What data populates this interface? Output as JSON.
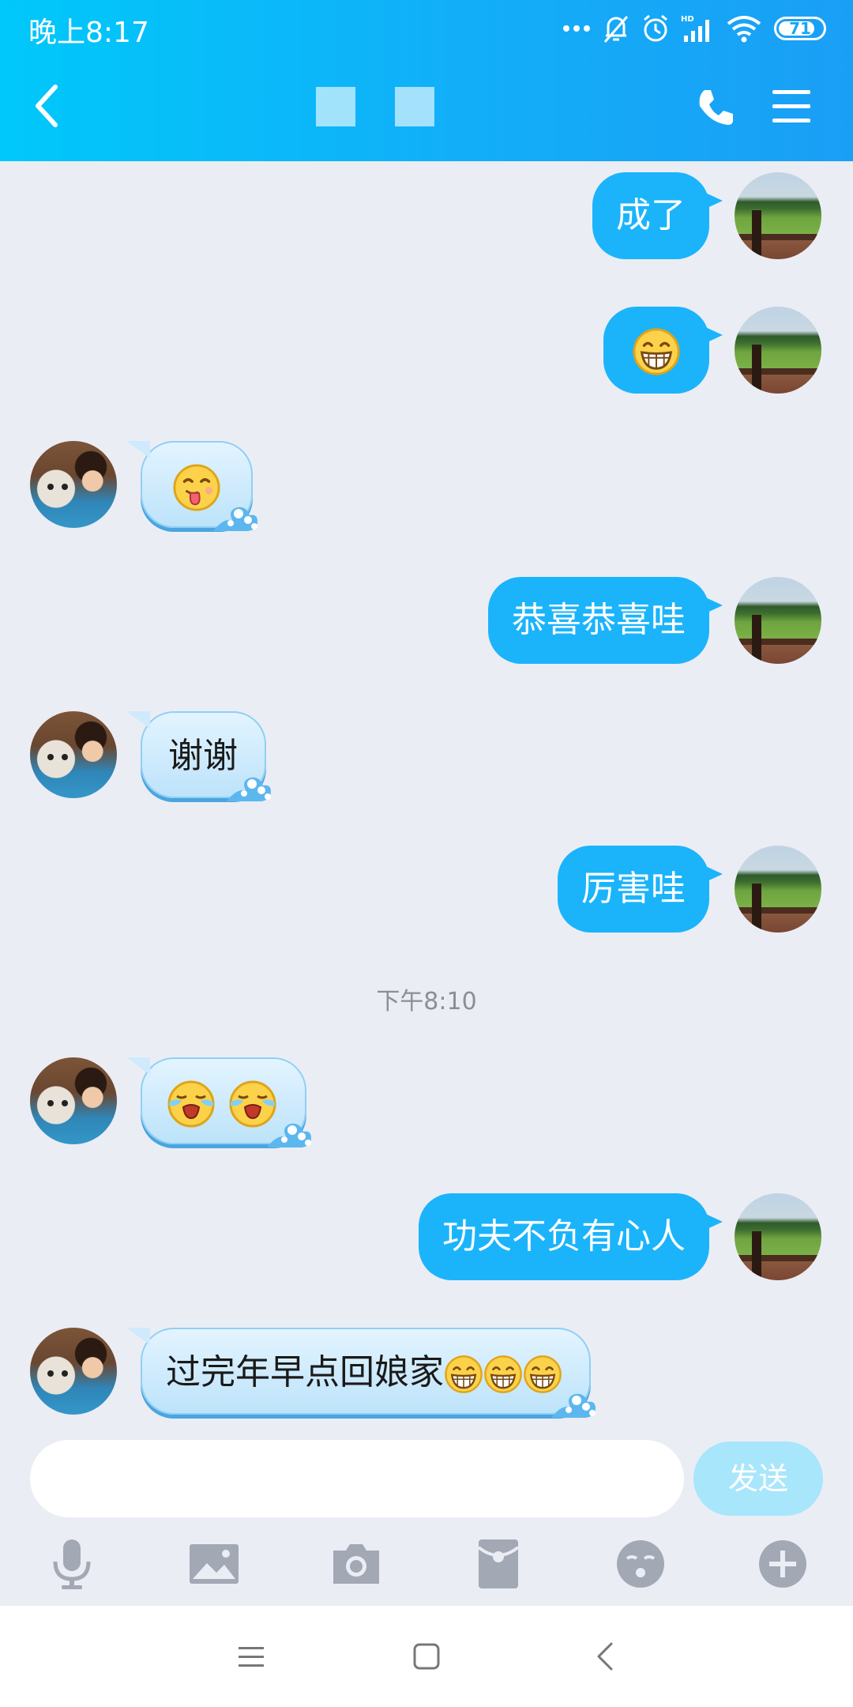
{
  "status": {
    "time": "晚上8:17",
    "battery": "71",
    "icons": [
      "more-dots-icon",
      "mute-bell-icon",
      "alarm-icon",
      "hd-signal-icon",
      "wifi-icon",
      "battery-icon"
    ]
  },
  "header": {
    "back_icon": "chevron-left-icon",
    "call_icon": "phone-icon",
    "menu_icon": "hamburger-menu-icon",
    "title_redacted": true
  },
  "messages": [
    {
      "sender": "me",
      "type": "text",
      "text": "成了"
    },
    {
      "sender": "me",
      "type": "emoji",
      "emoji": "grin-emoji"
    },
    {
      "sender": "friend",
      "type": "emoji",
      "emoji": "tongue-out-emoji"
    },
    {
      "sender": "me",
      "type": "text",
      "text": "恭喜恭喜哇"
    },
    {
      "sender": "friend",
      "type": "text",
      "text": "谢谢"
    },
    {
      "sender": "me",
      "type": "text",
      "text": "厉害哇"
    },
    {
      "sender": "friend",
      "type": "emoji",
      "emoji": "crying-emoji",
      "count": 2
    },
    {
      "sender": "me",
      "type": "text",
      "text": "功夫不负有心人"
    },
    {
      "sender": "friend",
      "type": "text",
      "text": "过完年早点回娘家",
      "trailing_emoji": "grin-emoji",
      "trailing_count": 3
    }
  ],
  "time_divider": "下午8:10",
  "composer": {
    "placeholder": "",
    "send_label": "发送"
  },
  "toolbar": [
    "microphone-icon",
    "image-icon",
    "camera-icon",
    "red-packet-icon",
    "emoji-icon",
    "plus-icon"
  ],
  "nav": [
    "recent-apps-icon",
    "home-icon",
    "back-icon"
  ],
  "colors": {
    "header_start": "#00c8fa",
    "header_end": "#1a9ff6",
    "my_bubble": "#1bb4fb",
    "friend_bubble": "#cdeafc",
    "background": "#ebedf5"
  }
}
